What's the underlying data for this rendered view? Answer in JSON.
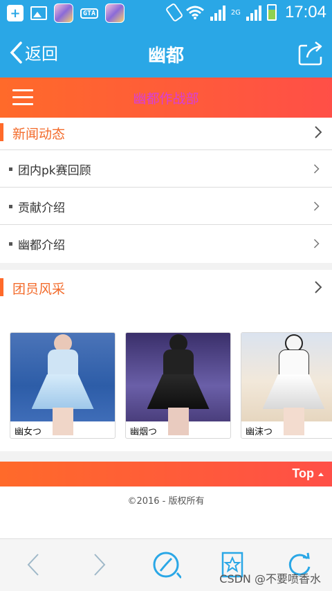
{
  "status_bar": {
    "gta_label": "GTA",
    "time": "17:04",
    "network": "2G"
  },
  "header": {
    "back_label": "返回",
    "title": "幽都"
  },
  "menu_bar": {
    "title": "幽都作战部"
  },
  "news": {
    "title": "新闻动态",
    "items": [
      {
        "label": "团内pk赛回顾"
      },
      {
        "label": "贡献介绍"
      },
      {
        "label": "幽都介绍"
      }
    ]
  },
  "members": {
    "title": "团员风采",
    "cards": [
      {
        "name": "幽女つ"
      },
      {
        "name": "幽烟つ"
      },
      {
        "name": "幽沫つ"
      }
    ]
  },
  "footer": {
    "top_label": "Top",
    "copyright": "©2016 - 版权所有"
  },
  "watermark": "CSDN @不要喷香水",
  "colors": {
    "header_blue": "#2aa7e6",
    "accent_orange": "#ff6a2a",
    "menu_title_magenta": "#d83fd5"
  }
}
